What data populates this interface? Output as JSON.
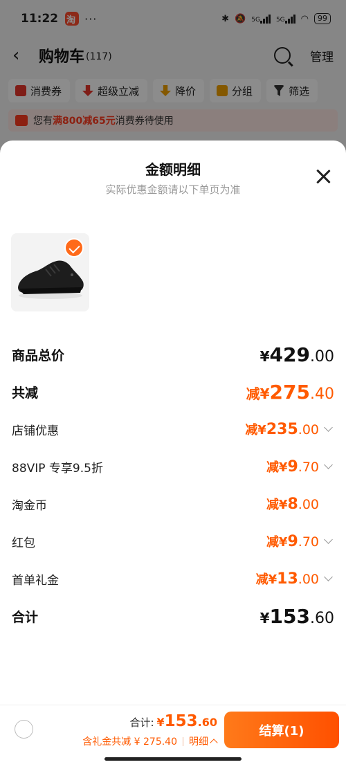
{
  "status_bar": {
    "time": "11:22",
    "dots": "···",
    "net1": "5G",
    "net2": "5G",
    "battery": "99"
  },
  "cart_header": {
    "title": "购物车",
    "count": "(117)",
    "manage": "管理"
  },
  "filters": [
    {
      "label": "消费券",
      "icon": "coupon-icon",
      "color": "#e8362a"
    },
    {
      "label": "超级立减",
      "icon": "down-arrow-icon",
      "color": "#e8362a"
    },
    {
      "label": "降价",
      "icon": "price-drop-icon",
      "color": "#f0a100"
    },
    {
      "label": "分组",
      "icon": "folder-icon",
      "color": "#f0a100"
    },
    {
      "label": "筛选",
      "icon": "filter-icon",
      "color": "#333333"
    }
  ],
  "coupon_banner": {
    "prefix": "您有",
    "highlight": "满800减65元",
    "suffix": "消费券待使用"
  },
  "sheet": {
    "title": "金额明细",
    "subtitle": "实际优惠金额请以下单页为准",
    "rows": [
      {
        "label": "商品总价",
        "prefix": "¥",
        "int": "429",
        "dec": ".00"
      },
      {
        "label": "共减",
        "prefix": "减¥",
        "int": "275",
        "dec": ".40"
      },
      {
        "label": "店铺优惠",
        "prefix": "减¥",
        "int": "235",
        "dec": ".00"
      },
      {
        "label": "88VIP 专享9.5折",
        "prefix": "减¥",
        "int": "9",
        "dec": ".70"
      },
      {
        "label": "淘金币",
        "prefix": "减¥",
        "int": "8",
        "dec": ".00"
      },
      {
        "label": "红包",
        "prefix": "减¥",
        "int": "9",
        "dec": ".70"
      },
      {
        "label": "首单礼金",
        "prefix": "减¥",
        "int": "13",
        "dec": ".00"
      },
      {
        "label": "合计",
        "prefix": "¥",
        "int": "153",
        "dec": ".60"
      }
    ]
  },
  "bottom_bar": {
    "total_label": "合计:",
    "total_yen": "¥",
    "total_int": "153",
    "total_dec": ".60",
    "discount_text": "含礼金共减 ¥ 275.40",
    "detail_label": "明细",
    "checkout_label": "结算(1)"
  },
  "colors": {
    "accent": "#ff5a00",
    "checkout_gradient_start": "#ff7a1a",
    "checkout_gradient_end": "#ff5000"
  }
}
